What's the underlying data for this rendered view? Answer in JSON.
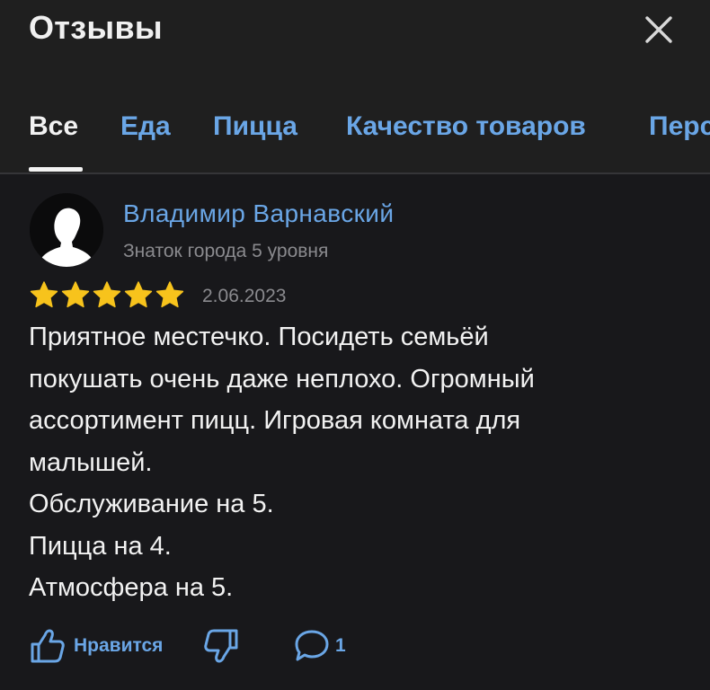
{
  "header": {
    "title": "Отзывы"
  },
  "tabs": [
    {
      "label": "Все",
      "active": true
    },
    {
      "label": "Еда",
      "active": false
    },
    {
      "label": "Пицца",
      "active": false
    },
    {
      "label": "Качество товаров",
      "active": false
    },
    {
      "label": "Персонал",
      "active": false
    }
  ],
  "review": {
    "author": "Владимир Варнавский",
    "level": "Знаток города 5 уровня",
    "rating": 5,
    "rating_max": 5,
    "date": "2.06.2023",
    "text_lines": [
      "Приятное местечко. Посидеть семьёй",
      "покушать очень даже неплохо. Огромный",
      "ассортимент пицц. Игровая комната для",
      "малышей.",
      "Обслуживание на 5.",
      "Пицца на 4.",
      "Атмосфера на 5."
    ],
    "actions": {
      "like_label": "Нравится",
      "comment_count": "1"
    }
  },
  "colors": {
    "background": "#18181b",
    "header_background": "#1f1f1f",
    "link": "#6aa6e6",
    "star": "#f7c31c",
    "muted_text": "#8a8a8e"
  },
  "icons": {
    "close": "close-icon",
    "avatar": "user-silhouette-icon",
    "star": "star-icon",
    "like": "thumbs-up-icon",
    "dislike": "thumbs-down-icon",
    "comment": "comment-bubble-icon"
  }
}
